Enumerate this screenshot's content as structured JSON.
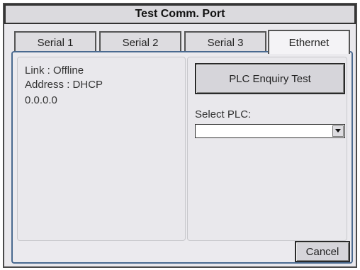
{
  "window": {
    "title": "Test Comm. Port"
  },
  "tabs": [
    {
      "label": "Serial 1",
      "active": false
    },
    {
      "label": "Serial 2",
      "active": false
    },
    {
      "label": "Serial 3",
      "active": false
    },
    {
      "label": "Ethernet",
      "active": true
    }
  ],
  "status": {
    "link_line": "Link   : Offline",
    "address_line": "Address : DHCP",
    "ip": "0.0.0.0"
  },
  "enquiry": {
    "button_label": "PLC Enquiry Test",
    "select_label": "Select PLC:",
    "select_value": "",
    "dropdown_icon": "chevron-down-icon"
  },
  "footer": {
    "cancel_label": "Cancel"
  },
  "colors": {
    "panel_border": "#4a6a90",
    "background": "#e9e8ec"
  }
}
